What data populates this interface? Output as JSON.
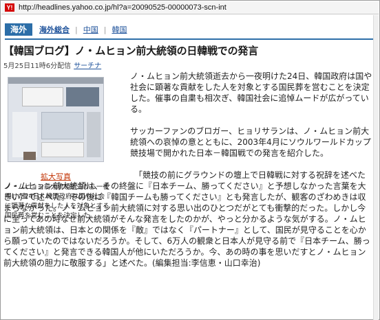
{
  "browser": {
    "url": "http://headlines.yahoo.co.jp/hl?a=20090525-00000073-scn-int",
    "favicon_label": "Y!"
  },
  "nav": {
    "section": "海外",
    "links": [
      "海外総合",
      "中国",
      "韓国"
    ],
    "separator": "|"
  },
  "article": {
    "headline": "【韓国ブログ】ノ・ムヒョン前大統領の日韓戦での発言",
    "date": "5月25日11時6分配信",
    "source": "サーチナ",
    "photo_link": "拡大写真",
    "photo_caption": "ノ・ムヒョン前大統領逝去から一夜明けた24日、韓国政府は国や社会に顕著な貢献をした人を対象とする国民葬を営むことを決定した。",
    "paragraphs": [
      "ノ・ムヒョン前大統領逝去から一夜明けた24日、韓国政府は国や社会に顕著な貢献をした人を対象とする国民葬を営むことを決定した。催事の自粛も相次ぎ、韓国社会に追悼ムードが広がっている。",
      "サッカーファンのブロガー、ヒョリサランは、ノ・ムヒョン前大統領への哀悼の意とともに、2003年4月にソウルワールドカップ競技場で開かれた日本－韓国戦での発言を紹介した。",
      "「競技の前にグラウンドの壇上で日韓戦に対する祝辞を述べたノ・ムヒョン前大統領は、その終盤に『日本チーム、勝ってください』と予想しなかった言葉を大きい声で述べた。その後に『韓国チームも勝ってください』とも発言したが、観客のざわめきは収まらなかった。ノ・ムヒョン前大統領に対する思い出のひとつだがとても衝撃的だった。しかし今に至ってあの時なぜ前大統領がそんな発言をしたのかが、やっと分かるような気がする。ノ・ムヒョン前大統領は、日本との関係を『敵』ではなく『パートナー』として、国民が見守ることを心から願っていたのではないだろうか。そして、6万人の観衆と日本人が見守る前で『日本チーム、勝ってください』と発言できる韓国人が他にいただろうか。今、あの時の事を思いだすとノ・ムヒョン前大統領の胆力に敬服する」と述べた。(編集担当:李信恵・山口幸治)"
    ]
  },
  "colors": {
    "nav_badge": "#2c6ea8",
    "link": "#1a4f99",
    "photo_link": "#c03000"
  }
}
